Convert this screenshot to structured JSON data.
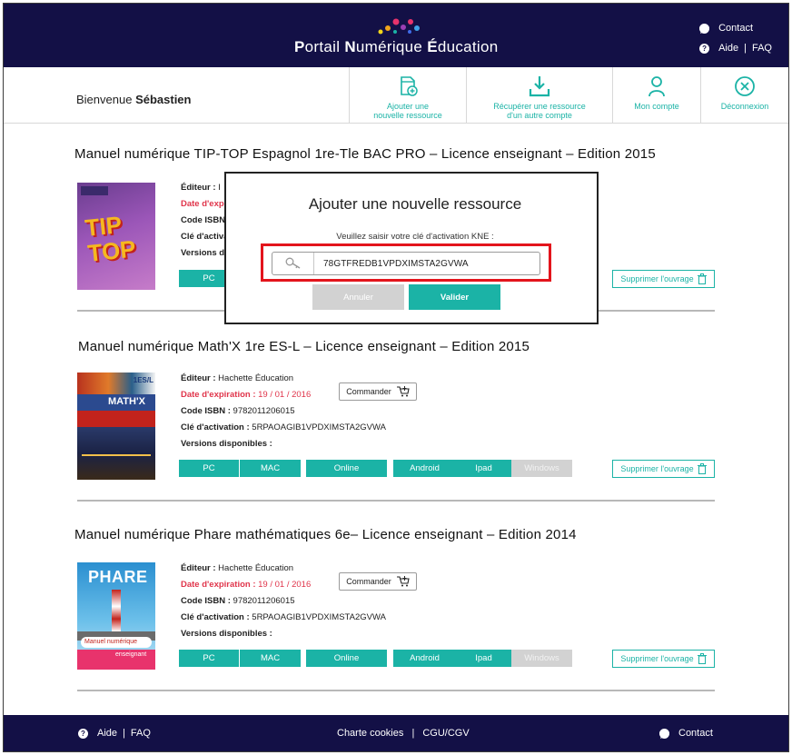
{
  "header": {
    "brand_p": "P",
    "brand_1": "ortail ",
    "brand_n": "N",
    "brand_2": "umérique ",
    "brand_e": "É",
    "brand_3": "ducation",
    "contact": "Contact",
    "aide": "Aide",
    "faq": "FAQ"
  },
  "subheader": {
    "welcome_prefix": "Bienvenue ",
    "user_name": "Sébastien",
    "nav": [
      {
        "label1": "Ajouter une",
        "label2": "nouvelle ressource",
        "icon": "add-document-icon"
      },
      {
        "label1": "Récupérer une ressource",
        "label2": "d'un autre compte",
        "icon": "download-icon"
      },
      {
        "label1": "Mon compte",
        "label2": "",
        "icon": "user-icon"
      },
      {
        "label1": "Déconnexion",
        "label2": "",
        "icon": "close-circle-icon"
      }
    ]
  },
  "products": [
    {
      "title": "Manuel numérique TIP-TOP Espagnol 1re-Tle BAC PRO – Licence enseignant – Edition 2015",
      "editeur_label": "Éditeur : ",
      "editeur_partial": "I",
      "expiration_partial": "Date d'exp",
      "isbn_partial": "Code ISBN",
      "cle_partial": "Clé d'activation",
      "versions_partial": "Versions d",
      "cover_text": "TIP TOP",
      "versions": [
        {
          "label": "PC",
          "enabled": true
        }
      ],
      "delete_label": "Supprimer l'ouvrage"
    },
    {
      "title": "Manuel numérique Math'X 1re ES-L – Licence enseignant – Edition 2015",
      "editeur_label": "Éditeur : ",
      "editeur": "Hachette Éducation",
      "expiration_label": "Date d'expiration : ",
      "expiration": "19 / 01 / 2016",
      "isbn_label": "Code ISBN : ",
      "isbn": "9782011206015",
      "cle_label": "Clé d'activation : ",
      "cle": "5RPAOAGIB1VPDXIMSTA2GVWA",
      "versions_label": "Versions disponibles :",
      "order_label": "Commander",
      "cover_text": "MATH'X",
      "cover_badge": "1ES/L",
      "versions": [
        {
          "label": "PC",
          "enabled": true
        },
        {
          "label": "MAC",
          "enabled": true
        },
        {
          "label": "Online",
          "enabled": true
        },
        {
          "label": "Android",
          "enabled": true
        },
        {
          "label": "Ipad",
          "enabled": true
        },
        {
          "label": "Windows",
          "enabled": false
        }
      ],
      "delete_label": "Supprimer l'ouvrage"
    },
    {
      "title": "Manuel numérique Phare mathématiques 6e– Licence enseignant – Edition 2014",
      "editeur_label": "Éditeur : ",
      "editeur": "Hachette Éducation",
      "expiration_label": "Date d'expiration : ",
      "expiration": "19 / 01 / 2016",
      "isbn_label": "Code ISBN : ",
      "isbn": "9782011206015",
      "cle_label": "Clé d'activation : ",
      "cle": "5RPAOAGIB1VPDXIMSTA2GVWA",
      "versions_label": "Versions disponibles :",
      "order_label": "Commander",
      "cover_text": "PHARE",
      "cover_sub1": "Manuel numérique",
      "cover_sub2": "enseignant",
      "versions": [
        {
          "label": "PC",
          "enabled": true
        },
        {
          "label": "MAC",
          "enabled": true
        },
        {
          "label": "Online",
          "enabled": true
        },
        {
          "label": "Android",
          "enabled": true
        },
        {
          "label": "Ipad",
          "enabled": true
        },
        {
          "label": "Windows",
          "enabled": false
        }
      ],
      "delete_label": "Supprimer l'ouvrage"
    }
  ],
  "modal": {
    "title": "Ajouter une nouvelle ressource",
    "label": "Veuillez saisir votre clé d'activation KNE :",
    "key_value": "78GTFREDB1VPDXIMSTA2GVWA",
    "cancel": "Annuler",
    "validate": "Valider"
  },
  "footer": {
    "aide": "Aide",
    "faq": "FAQ",
    "charte": "Charte cookies",
    "cgu": "CGU/CGV",
    "contact": "Contact"
  },
  "colors": {
    "navy": "#131046",
    "teal": "#1bb3a6",
    "red_expiration": "#e0354b",
    "highlight_red": "#e3141c"
  }
}
